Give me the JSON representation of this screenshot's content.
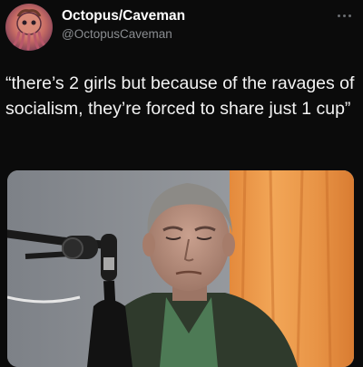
{
  "tweet": {
    "author_name": "Octopus/Caveman",
    "author_handle": "@OctopusCaveman",
    "text": "“there’s 2 girls but because of the ravages of socialism, they’re forced to share just 1 cup”"
  },
  "icons": {
    "more": "more-horizontal-icon",
    "avatar": "octopus-caveman-avatar",
    "media": "video-still-man-at-microphone"
  },
  "colors": {
    "background": "#0b0b0b",
    "text": "#f3f3f3",
    "handle": "#8a8d91"
  }
}
